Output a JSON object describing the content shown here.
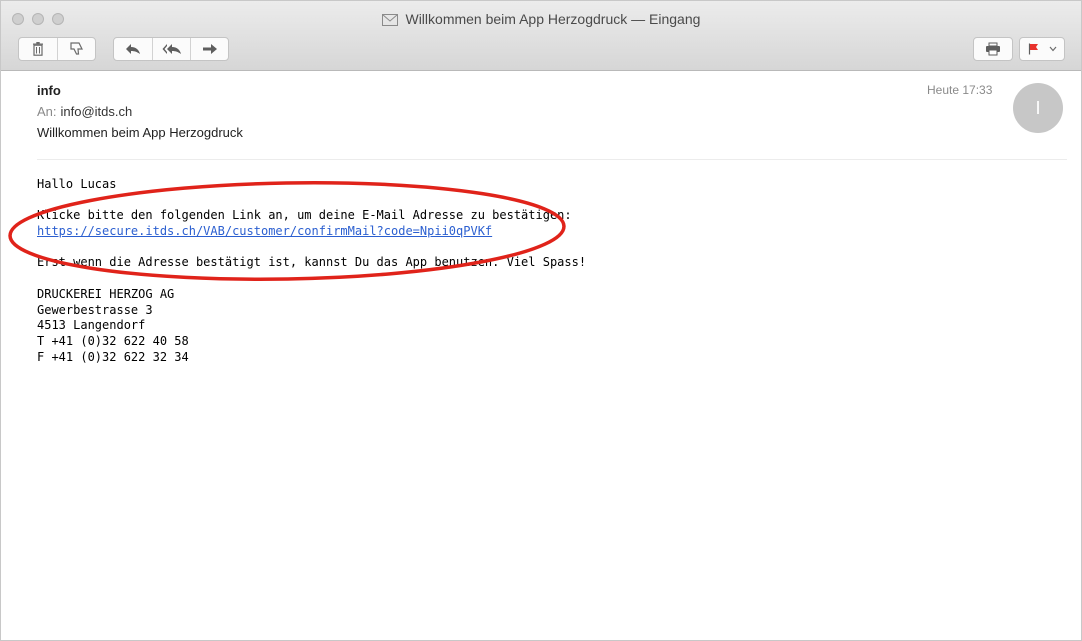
{
  "window": {
    "title": "Willkommen beim App Herzogdruck — Eingang"
  },
  "toolbar": {
    "delete_icon": "trash-icon",
    "junk_icon": "thumbs-down-icon",
    "reply_icon": "reply-icon",
    "reply_all_icon": "reply-all-icon",
    "forward_icon": "forward-icon",
    "print_icon": "printer-icon",
    "flag_icon": "flag-icon",
    "flag_color": "#e8312c"
  },
  "message": {
    "from": "info",
    "to_label": "An:",
    "to": "info@itds.ch",
    "subject": "Willkommen beim App Herzogdruck",
    "date": "Heute 17:33",
    "avatar_initial": "I",
    "body": {
      "greeting": "Hallo Lucas",
      "instruction": "Klicke bitte den folgenden Link an, um deine E-Mail Adresse zu bestätigen:",
      "link": "https://secure.itds.ch/VAB/customer/confirmMail?code=Npii0qPVKf",
      "note": "Erst wenn die Adresse bestätigt ist, kannst Du das App benutzen. Viel Spass!",
      "signature": [
        "DRUCKEREI HERZOG AG",
        "Gewerbestrasse 3",
        "4513 Langendorf",
        "T +41 (0)32 622 40 58",
        "F +41 (0)32 622 32 34"
      ]
    }
  },
  "annotation": {
    "color": "#e0231a"
  }
}
